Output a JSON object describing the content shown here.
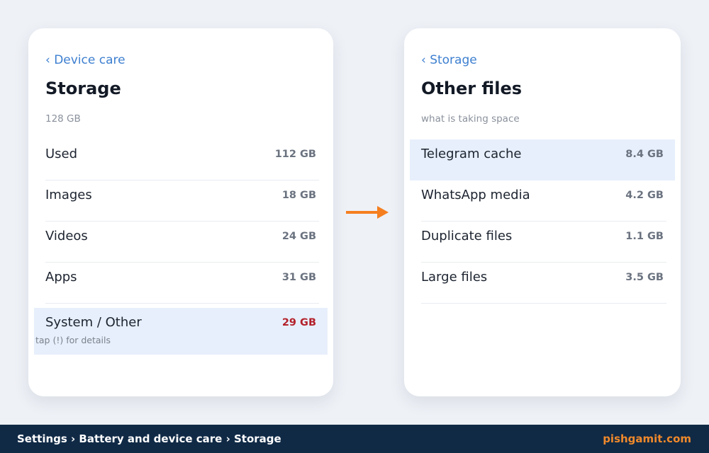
{
  "colors": {
    "background": "#eef1f6",
    "link": "#3d7fd0",
    "highlight_row": "#e7effc",
    "alert_value": "#b3212b",
    "arrow": "#f57f20",
    "footer_bg": "#102a46",
    "footer_brand": "#f0892b"
  },
  "left_card": {
    "back_label": "‹ Device care",
    "title": "Storage",
    "subtitle": "128 GB",
    "rows": [
      {
        "label": "Used",
        "value": "112 GB"
      },
      {
        "label": "Images",
        "value": "18 GB"
      },
      {
        "label": "Videos",
        "value": "24 GB"
      },
      {
        "label": "Apps",
        "value": "31 GB"
      },
      {
        "label": "System / Other",
        "value": "29 GB",
        "note": "tap (!) for details"
      }
    ]
  },
  "flow_arrow": {
    "icon": "arrow-right-icon"
  },
  "right_card": {
    "back_label": "‹ Storage",
    "title": "Other files",
    "subtitle": "what is taking space",
    "rows": [
      {
        "label": "Telegram cache",
        "value": "8.4 GB"
      },
      {
        "label": "WhatsApp media",
        "value": "4.2 GB"
      },
      {
        "label": "Duplicate files",
        "value": "1.1 GB"
      },
      {
        "label": "Large files",
        "value": "3.5 GB"
      }
    ]
  },
  "footer": {
    "path": "Settings › Battery and device care › Storage",
    "brand": "pishgamit.com"
  }
}
